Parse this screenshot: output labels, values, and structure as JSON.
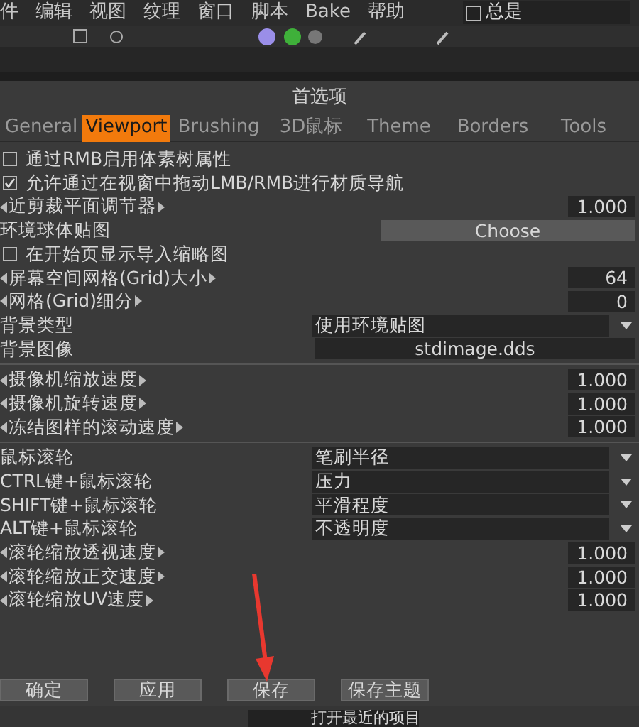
{
  "menu": [
    "件",
    "编辑",
    "视图",
    "纹理",
    "窗口",
    "脚本",
    "Bake",
    "帮助"
  ],
  "always": {
    "label": "总是",
    "checked": false
  },
  "dialog": {
    "title": "首选项",
    "tabs": [
      {
        "label": "General",
        "selected": false
      },
      {
        "label": "Viewport",
        "selected": true
      },
      {
        "label": "Brushing",
        "selected": false
      },
      {
        "label": "3D鼠标",
        "selected": false
      },
      {
        "label": "Theme",
        "selected": false
      },
      {
        "label": "Borders",
        "selected": false
      },
      {
        "label": "Tools",
        "selected": false
      }
    ],
    "groups": [
      [
        {
          "kind": "checkbox",
          "label": "通过RMB启用体素树属性",
          "checked": false
        },
        {
          "kind": "checkbox",
          "label": "允许通过在视窗中拖动LMB/RMB进行材质导航",
          "checked": true
        },
        {
          "kind": "number",
          "label": "近剪裁平面调节器",
          "value": "1.000"
        },
        {
          "kind": "button",
          "label": "环境球体贴图",
          "value": "Choose"
        },
        {
          "kind": "checkbox",
          "label": "在开始页显示导入缩略图",
          "checked": false
        },
        {
          "kind": "number",
          "label": "屏幕空间网格(Grid)大小",
          "value": "64"
        },
        {
          "kind": "number",
          "label": "网格(Grid)细分",
          "value": "0"
        },
        {
          "kind": "dropdown",
          "label": "背景类型",
          "value": "使用环境贴图"
        },
        {
          "kind": "file",
          "label": "背景图像",
          "value": "stdimage.dds"
        }
      ],
      [
        {
          "kind": "number",
          "label": "摄像机缩放速度",
          "value": "1.000"
        },
        {
          "kind": "number",
          "label": "摄像机旋转速度",
          "value": "1.000"
        },
        {
          "kind": "number",
          "label": "冻结图样的滚动速度",
          "value": "1.000"
        }
      ],
      [
        {
          "kind": "dropdown",
          "label": "鼠标滚轮",
          "value": "笔刷半径"
        },
        {
          "kind": "dropdown",
          "label": "CTRL键+鼠标滚轮",
          "value": "压力"
        },
        {
          "kind": "dropdown",
          "label": "SHIFT键+鼠标滚轮",
          "value": "平滑程度"
        },
        {
          "kind": "dropdown",
          "label": "ALT键+鼠标滚轮",
          "value": "不透明度"
        },
        {
          "kind": "number",
          "label": "滚轮缩放透视速度",
          "value": "1.000"
        },
        {
          "kind": "number",
          "label": "滚轮缩放正交速度",
          "value": "1.000"
        },
        {
          "kind": "number",
          "label": "滚轮缩放UV速度",
          "value": "1.000"
        }
      ]
    ],
    "buttons": [
      "确定",
      "应用",
      "保存",
      "保存主题"
    ]
  },
  "recent": "打开最近的项目"
}
